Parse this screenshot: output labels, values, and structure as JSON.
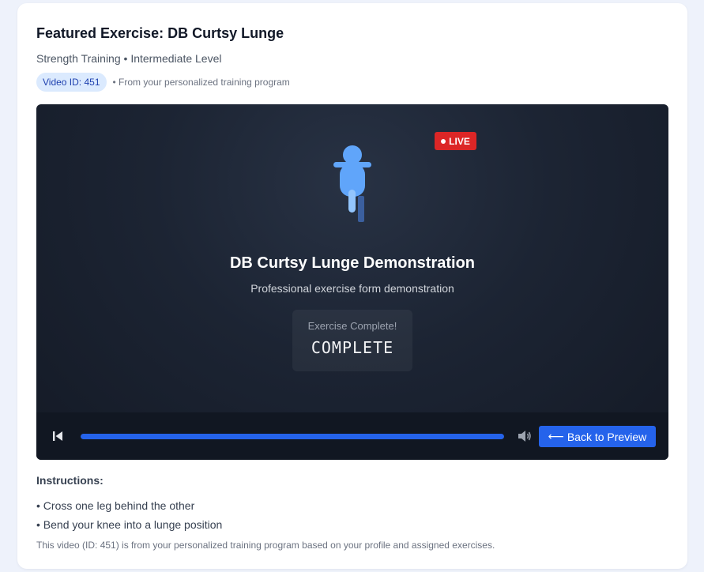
{
  "header": {
    "title": "Featured Exercise: DB Curtsy Lunge",
    "category": "Strength Training",
    "separator": "•",
    "level": "Intermediate Level",
    "video_badge": "Video ID: 451",
    "source_note": "• From your personalized training program"
  },
  "player": {
    "live_label": "LIVE",
    "demo_title": "DB Curtsy Lunge Demonstration",
    "demo_subtitle": "Professional exercise form demonstration",
    "status_label": "Exercise Complete!",
    "status_value": "COMPLETE",
    "progress_fraction": 1.0,
    "back_button_arrow": "⟵",
    "back_button_label": "Back to Preview"
  },
  "instructions": {
    "heading": "Instructions:",
    "items": [
      "• Cross one leg behind the other",
      "• Bend your knee into a lunge position"
    ]
  },
  "footnote": "This video (ID: 451) is from your personalized training program based on your profile and assigned exercises.",
  "colors": {
    "accent": "#2563eb",
    "live": "#dc2626",
    "badge_bg": "#dbeafe",
    "figure": "#60a5fa"
  },
  "icons": {
    "skip_back": "skip-back-icon",
    "volume": "volume-icon",
    "live_dot": "live-dot-icon",
    "figure": "exercise-figure-icon"
  }
}
